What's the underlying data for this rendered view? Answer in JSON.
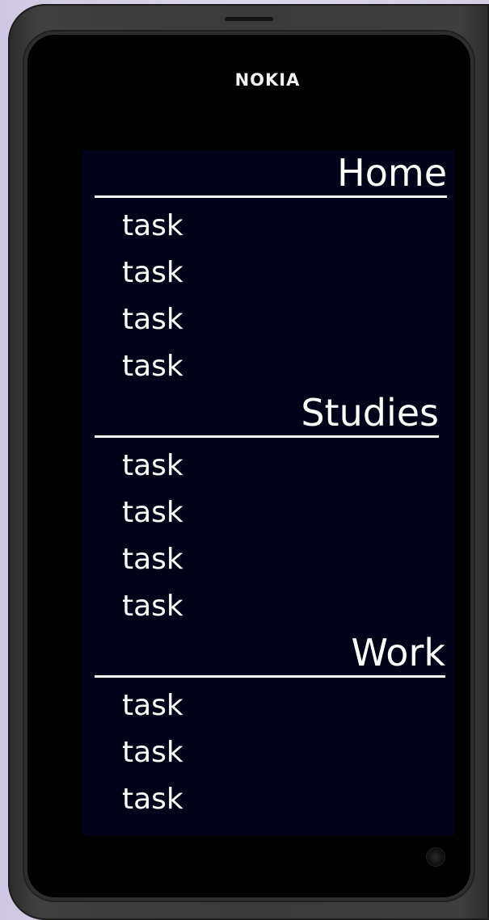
{
  "device": {
    "brand": "NOKIA"
  },
  "sections": [
    {
      "title": "Home",
      "tasks": [
        "task",
        "task",
        "task",
        "task"
      ]
    },
    {
      "title": "Studies",
      "tasks": [
        "task",
        "task",
        "task",
        "task"
      ]
    },
    {
      "title": "Work",
      "tasks": [
        "task",
        "task",
        "task"
      ]
    }
  ],
  "colors": {
    "screen_background": "#020218",
    "text": "#ffffff",
    "phone_body": "#3a3a3a"
  },
  "icons": {
    "front_camera": "camera-lens-icon"
  }
}
